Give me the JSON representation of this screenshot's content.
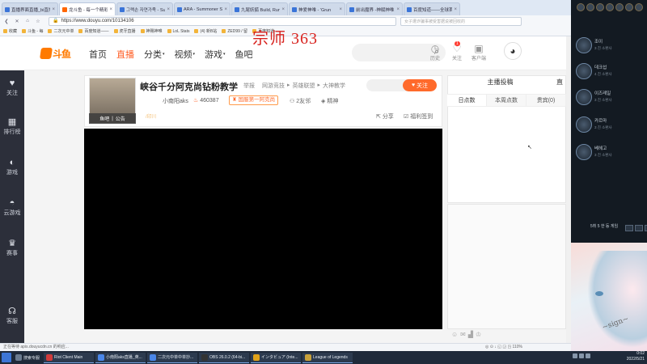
{
  "browser": {
    "tabs": [
      {
        "title": "直播界面直播_bi直播"
      },
      {
        "title": "龙斗鱼 - 每一个精彩...",
        "active": true
      },
      {
        "title": "그랙손 자연가족 - Su"
      },
      {
        "title": "ARA - Summoner St"
      },
      {
        "title": "九尾妖狐 Build, Rune"
      },
      {
        "title": "神爱神唯 - 'Grun"
      },
      {
        "title": "前出魔界 -神赋神唯"
      },
      {
        "title": "百度知道——全球首"
      }
    ],
    "url": "https://www.douyu.com/10134106",
    "search_placeholder": "女子遭诈骗事被受害据说被回收的",
    "bookmarks": [
      "收藏",
      "斗鱼 - 每",
      "二次元中单",
      "百度知道——",
      "虎牙直播",
      "神赐神唯",
      "LoL Stats",
      "(4) 新B站",
      "ZED99 / 留",
      "百度知道——"
    ]
  },
  "site": {
    "logo": "斗鱼",
    "nav": [
      {
        "label": "首页",
        "caret": ""
      },
      {
        "label": "直播",
        "caret": "",
        "active": true
      },
      {
        "label": "分类",
        "caret": "▾"
      },
      {
        "label": "视频",
        "caret": "▾"
      },
      {
        "label": "游戏",
        "caret": "▾"
      },
      {
        "label": "鱼吧",
        "caret": ""
      }
    ],
    "header_icons": [
      {
        "glyph": "◷",
        "label": "历史"
      },
      {
        "glyph": "♡",
        "label": "关注"
      },
      {
        "glyph": "▣",
        "label": "客户端"
      }
    ],
    "badge": "1"
  },
  "overlay_text": "宗师 363",
  "rail": [
    {
      "glyph": "♥",
      "label": "关注"
    },
    {
      "glyph": "▦",
      "label": "排行榜"
    },
    {
      "glyph": "◐",
      "label": "游戏"
    },
    {
      "glyph": "◓",
      "label": "云游戏"
    },
    {
      "glyph": "♛",
      "label": "赛事"
    },
    {
      "glyph": "☊",
      "label": "客服"
    }
  ],
  "room": {
    "title": "峡谷千分阿克尚钻粉教学",
    "report": "举报",
    "categories": [
      "网游竞技",
      "▸",
      "英雄联盟",
      "▸",
      "大神教学"
    ],
    "follow_label": "关注",
    "anchor": "小南阳aks",
    "heat": "460387",
    "rank_label": "国服第一阿克尚",
    "friends": "2友邻",
    "god": "精神",
    "share": "分享",
    "welfare": "福利签到",
    "thumb_tabs": [
      "鱼吧",
      "|",
      "公告"
    ],
    "signature": "/印川"
  },
  "side": {
    "headers": [
      "主播投稿",
      "直"
    ],
    "tabs": [
      "日点数",
      "本周点数",
      "贵宾(0)"
    ]
  },
  "statusbar": {
    "left": "正在等待 apis.douyucdn.cn 的响应...",
    "right": "◎ ⊙ ↓ ◱ ◲ ◳ 110%"
  },
  "right_panel": {
    "friends": [
      {
        "name": "조이",
        "sub": "3 친 소환사"
      },
      {
        "name": "데크섭",
        "sub": "4 친 소환사"
      },
      {
        "name": "이즈레일",
        "sub": "3 친 소환사"
      },
      {
        "name": "카르마",
        "sub": "3 친 소환사"
      },
      {
        "name": "베헤고",
        "sub": "3 친 소환사"
      }
    ],
    "footer_text": "5취 5 \n 한 등 게임"
  },
  "taskbar": {
    "items": [
      "搜索专服",
      "Riot Client Main",
      "小南阳aks直播_英...",
      "二次元中单中单抄...",
      "OBS 26.0.2 (64-bi...",
      "インタビュア (Inte...",
      "League of Legends"
    ],
    "time": "0:02",
    "date": "2022/5/21"
  }
}
